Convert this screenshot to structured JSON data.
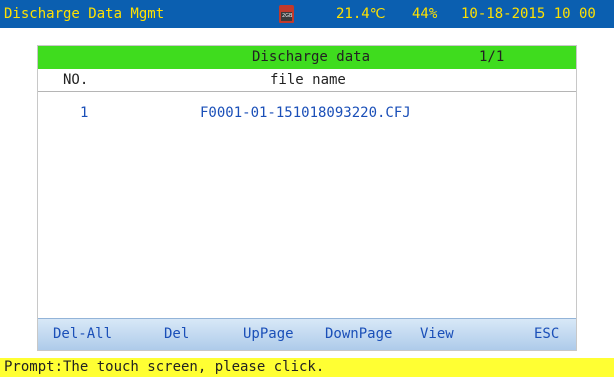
{
  "status_bar": {
    "title": "Discharge Data Mgmt",
    "sdcard_label": "2GB",
    "temperature": "21.4℃",
    "humidity": "44%",
    "datetime": "10-18-2015 10 00",
    "colors": {
      "background": "#0b5fb0",
      "text": "#ffe100"
    }
  },
  "panel": {
    "title": "Discharge data",
    "page": "1/1",
    "header_color": "#3fdc1e",
    "columns": [
      "NO.",
      "file name"
    ],
    "rows": [
      {
        "no": "1",
        "file": "F0001-01-151018093220.CFJ"
      }
    ]
  },
  "buttons": {
    "del_all": "Del-All",
    "del": "Del",
    "up_page": "UpPage",
    "down_page": "DownPage",
    "view": "View",
    "esc": "ESC"
  },
  "prompt": {
    "text": "Prompt:The touch screen, please click.",
    "color": "#ffff33"
  }
}
